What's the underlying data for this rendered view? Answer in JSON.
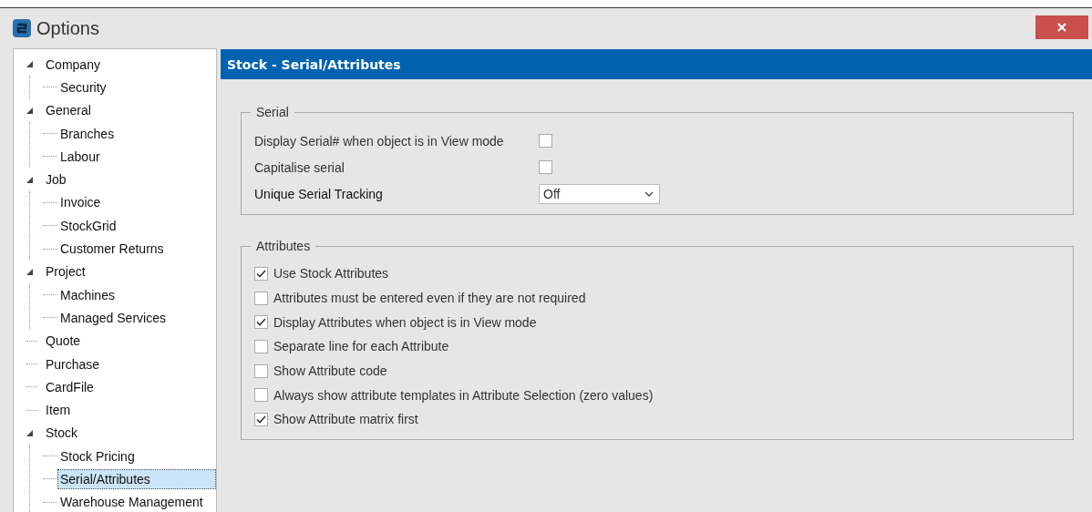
{
  "window": {
    "title": "Options"
  },
  "sidebar": {
    "items": [
      {
        "label": "Company",
        "expanded": true,
        "selected": false,
        "children": [
          {
            "label": "Security",
            "selected": false
          }
        ]
      },
      {
        "label": "General",
        "expanded": true,
        "selected": false,
        "children": [
          {
            "label": "Branches",
            "selected": false
          },
          {
            "label": "Labour",
            "selected": false
          }
        ]
      },
      {
        "label": "Job",
        "expanded": true,
        "selected": false,
        "children": [
          {
            "label": "Invoice",
            "selected": false
          },
          {
            "label": "StockGrid",
            "selected": false
          },
          {
            "label": "Customer Returns",
            "selected": false
          }
        ]
      },
      {
        "label": "Project",
        "expanded": true,
        "selected": false,
        "children": [
          {
            "label": "Machines",
            "selected": false
          },
          {
            "label": "Managed Services",
            "selected": false
          }
        ]
      },
      {
        "label": "Quote",
        "selected": false
      },
      {
        "label": "Purchase",
        "selected": false
      },
      {
        "label": "CardFile",
        "selected": false
      },
      {
        "label": "Item",
        "selected": false
      },
      {
        "label": "Stock",
        "expanded": true,
        "selected": false,
        "children": [
          {
            "label": "Stock Pricing",
            "selected": false
          },
          {
            "label": "Serial/Attributes",
            "selected": true
          },
          {
            "label": "Warehouse Management",
            "selected": false
          }
        ]
      }
    ]
  },
  "panel": {
    "title": "Stock - Serial/Attributes",
    "groups": [
      {
        "title": "Serial",
        "rows": [
          {
            "kind": "checkbox",
            "label": "Display Serial# when object is in View mode",
            "checked": false
          },
          {
            "kind": "checkbox",
            "label": "Capitalise serial",
            "checked": false
          },
          {
            "kind": "dropdown",
            "label": "Unique Serial Tracking",
            "value": "Off"
          }
        ]
      },
      {
        "title": "Attributes",
        "rows": [
          {
            "kind": "check",
            "label": "Use Stock Attributes",
            "checked": true
          },
          {
            "kind": "check",
            "label": "Attributes must be entered even if they are not required",
            "checked": false
          },
          {
            "kind": "check",
            "label": "Display Attributes when object is in View mode",
            "checked": true
          },
          {
            "kind": "check",
            "label": "Separate line for each Attribute",
            "checked": false
          },
          {
            "kind": "check",
            "label": "Show Attribute code",
            "checked": false
          },
          {
            "kind": "check",
            "label": "Always show attribute templates in Attribute Selection (zero values)",
            "checked": false
          },
          {
            "kind": "check",
            "label": "Show Attribute matrix first",
            "checked": true
          }
        ]
      }
    ]
  }
}
